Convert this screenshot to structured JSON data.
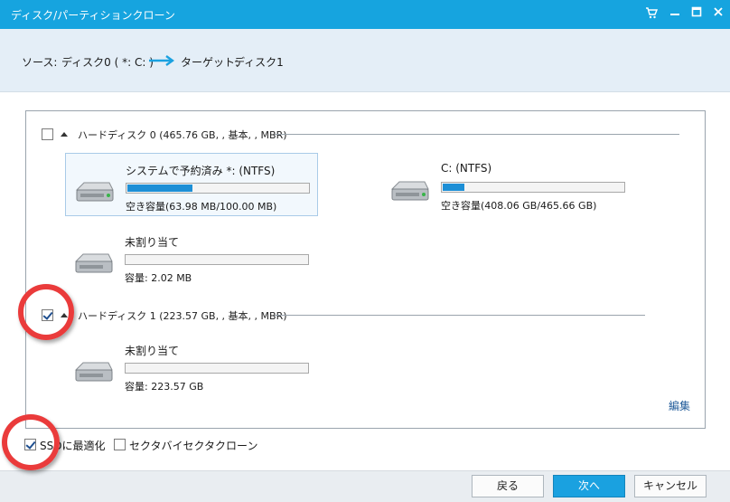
{
  "window": {
    "title": "ディスク/パーティションクローン",
    "controls": {
      "cart_icon": "cart-icon",
      "minimize_icon": "minimize-icon",
      "maximize_icon": "maximize-icon",
      "close_icon": "close-icon"
    }
  },
  "header": {
    "source_label": "ソース:",
    "source_value": "ディスク0 ( *: C: )",
    "target_label": "ターゲット:",
    "target_value": "ディスク1",
    "arrow_color": "#1aa1e0"
  },
  "disks": [
    {
      "title": "ハードディスク 0 (465.76 GB, , 基本, , MBR)",
      "checked": false,
      "partitions": [
        {
          "name": "システムで予約済み *: (NTFS)",
          "free_text": "空き容量(63.98 MB/100.00 MB)",
          "used_fraction": 0.36,
          "selected": true
        },
        {
          "name": "C: (NTFS)",
          "free_text": "空き容量(408.06 GB/465.66 GB)",
          "used_fraction": 0.12,
          "selected": false
        },
        {
          "name": "未割り当て",
          "free_text": "容量: 2.02 MB",
          "used_fraction": 0,
          "selected": false
        }
      ]
    },
    {
      "title": "ハードディスク 1 (223.57 GB, , 基本, , MBR)",
      "checked": true,
      "edit_label": "編集",
      "partitions": [
        {
          "name": "未割り当て",
          "free_text": "容量: 223.57 GB",
          "used_fraction": 0,
          "selected": false
        }
      ]
    }
  ],
  "options": {
    "ssd_optimize_label": "SSDに最適化",
    "ssd_optimize_checked": true,
    "sector_clone_label": "セクタバイセクタクローン",
    "sector_clone_checked": false
  },
  "buttons": {
    "back": "戻る",
    "next": "次へ",
    "cancel": "キャンセル"
  },
  "colors": {
    "title_bar": "#16a4df",
    "accent": "#1aa1e0",
    "bar_fill": "#1d8fd6",
    "annotation": "#ea3b3b"
  }
}
